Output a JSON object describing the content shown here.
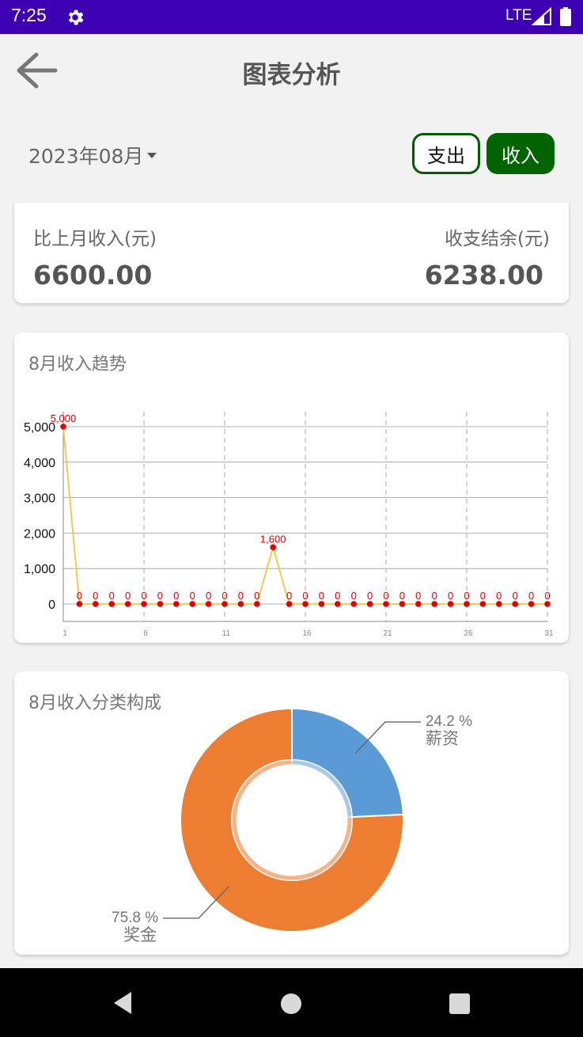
{
  "status_bar": {
    "time": "7:25",
    "network": "LTE",
    "settings_icon": "gear-icon",
    "signal_icon": "signal-icon",
    "battery_icon": "battery-icon"
  },
  "header": {
    "title": "图表分析",
    "back_icon": "arrow-left-icon"
  },
  "filter": {
    "month": "2023年08月",
    "expense_label": "支出",
    "income_label": "收入",
    "selected": "income"
  },
  "summary": {
    "left_label": "比上月收入(元)",
    "left_value": "6600.00",
    "right_label": "收支结余(元)",
    "right_value": "6238.00"
  },
  "trend": {
    "title": "8月收入趋势"
  },
  "composition": {
    "title": "8月收入分类构成"
  },
  "colors": {
    "status_bar": "#3d00b3",
    "primary_green": "#006400",
    "line": "#f5c63c",
    "point": "#e00000",
    "pie_salary": "#5b9bd5",
    "pie_bonus": "#ed7d31"
  },
  "chart_data": [
    {
      "type": "line",
      "x": [
        1,
        2,
        3,
        4,
        5,
        6,
        7,
        8,
        9,
        10,
        11,
        12,
        13,
        14,
        15,
        16,
        17,
        18,
        19,
        20,
        21,
        22,
        23,
        24,
        25,
        26,
        27,
        28,
        29,
        30,
        31
      ],
      "series": [
        {
          "values": [
            5000,
            0,
            0,
            0,
            0,
            0,
            0,
            0,
            0,
            0,
            0,
            0,
            0,
            1600,
            0,
            0,
            0,
            0,
            0,
            0,
            0,
            0,
            0,
            0,
            0,
            0,
            0,
            0,
            0,
            0,
            0
          ]
        }
      ],
      "data_labels": [
        "5,000",
        "0",
        "0",
        "0",
        "0",
        "0",
        "0",
        "0",
        "0",
        "0",
        "0",
        "0",
        "0",
        "1,600",
        "0",
        "0",
        "0",
        "0",
        "0",
        "0",
        "0",
        "0",
        "0",
        "0",
        "0",
        "0",
        "0",
        "0",
        "0",
        "0",
        "0"
      ],
      "xticks": [
        1,
        6,
        11,
        16,
        21,
        26,
        31
      ],
      "yticks": [
        0,
        1000,
        2000,
        3000,
        4000,
        5000
      ],
      "ytick_labels": [
        "0",
        "1,000",
        "2,000",
        "3,000",
        "4,000",
        "5,000"
      ],
      "xlim": [
        1,
        31
      ],
      "ylim": [
        0,
        5000
      ],
      "grid": "horizontal solid, vertical dashed"
    },
    {
      "type": "pie",
      "style": "donut",
      "slices": [
        {
          "label": "薪资",
          "percent_label": "24.2 %",
          "value": 24.2,
          "color": "#5b9bd5"
        },
        {
          "label": "奖金",
          "percent_label": "75.8 %",
          "value": 75.8,
          "color": "#ed7d31"
        }
      ]
    }
  ]
}
